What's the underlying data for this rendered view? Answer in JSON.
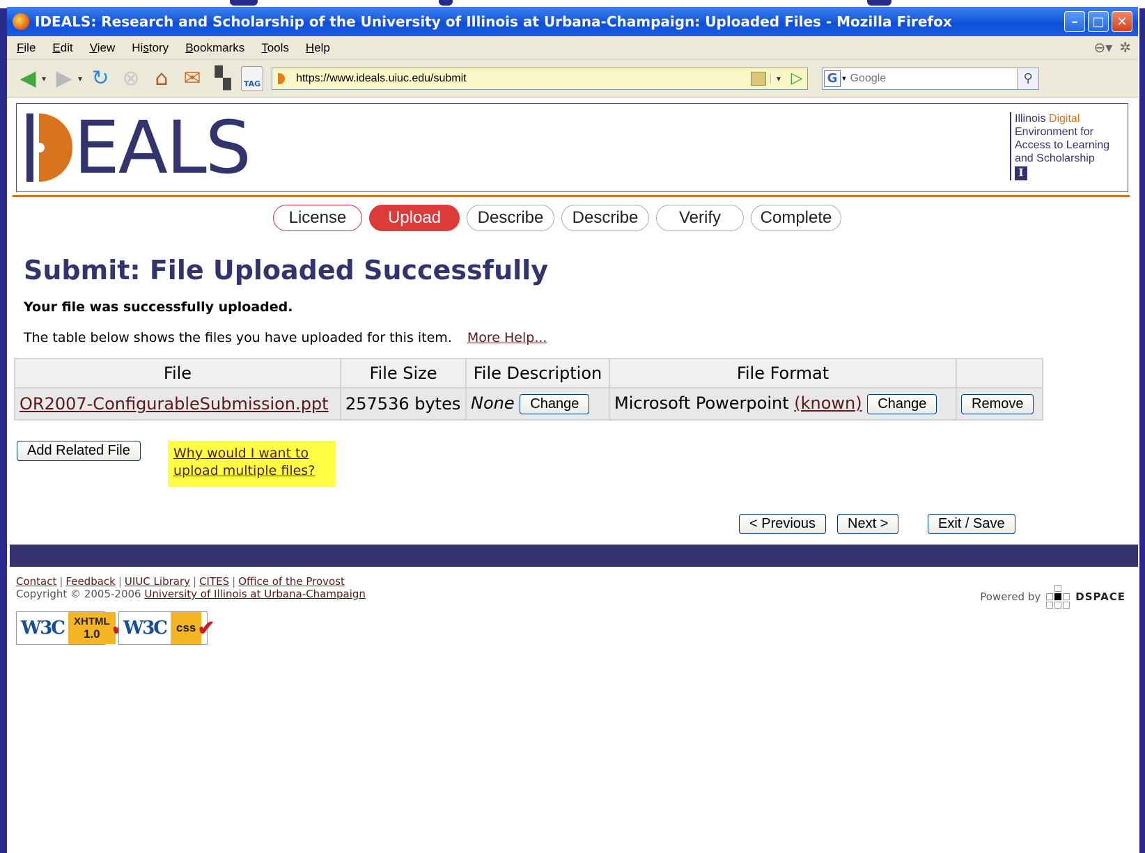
{
  "window": {
    "title": "IDEALS: Research and Scholarship of the University of Illinois at Urbana-Champaign: Uploaded Files - Mozilla Firefox"
  },
  "menu": [
    {
      "pre": "",
      "ul": "F",
      "post": "ile"
    },
    {
      "pre": "",
      "ul": "E",
      "post": "dit"
    },
    {
      "pre": "",
      "ul": "V",
      "post": "iew"
    },
    {
      "pre": "Hi",
      "ul": "s",
      "post": "tory"
    },
    {
      "pre": "",
      "ul": "B",
      "post": "ookmarks"
    },
    {
      "pre": "",
      "ul": "T",
      "post": "ools"
    },
    {
      "pre": "",
      "ul": "H",
      "post": "elp"
    }
  ],
  "navbar": {
    "url": "https://www.ideals.uiuc.edu/submit",
    "search_placeholder": "Google",
    "tag_label": "TAG"
  },
  "header": {
    "logo_text": "EALS",
    "tagline": [
      "Illinois",
      "Digital",
      "Environment for",
      "Access to Learning",
      "and Scholarship"
    ],
    "tagline_mark": "I"
  },
  "steps": [
    "License",
    "Upload",
    "Describe",
    "Describe",
    "Verify",
    "Complete"
  ],
  "page": {
    "title": "Submit: File Uploaded Successfully",
    "success": "Your file was successfully uploaded.",
    "description": "The table below shows the files you have uploaded for this item.",
    "more_help": "More Help..."
  },
  "table": {
    "headers": [
      "File",
      "File Size",
      "File Description",
      "File Format",
      ""
    ],
    "row": {
      "file": "OR2007-ConfigurableSubmission.ppt",
      "size": "257536 bytes",
      "description": "None",
      "change_desc": "Change",
      "format": "Microsoft Powerpoint",
      "format_status": "(known)",
      "change_format": "Change",
      "remove": "Remove"
    }
  },
  "actions": {
    "add_related": "Add Related File",
    "help_link": "Why would I want to upload multiple files?",
    "previous": "< Previous",
    "next": "Next >",
    "exit": "Exit / Save"
  },
  "footer": {
    "links": [
      "Contact",
      "Feedback",
      "UIUC Library",
      "CITES",
      "Office of the Provost"
    ],
    "copyright": "Copyright © 2005-2006",
    "university": "University of Illinois at Urbana-Champaign",
    "badge_xhtml": [
      "XHTML",
      "1.0"
    ],
    "badge_css": "css",
    "badge_w3c": "W3C",
    "powered_by": "Powered by",
    "dspace": "DSPACE"
  }
}
